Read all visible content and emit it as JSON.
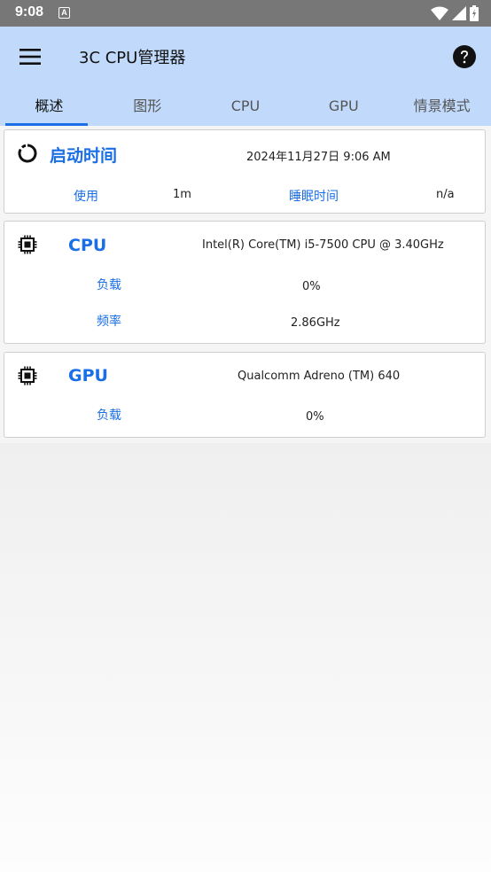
{
  "status_bar": {
    "time": "9:08",
    "notification_icon": "A"
  },
  "app_bar": {
    "title": "3C CPU管理器"
  },
  "tabs": [
    {
      "label": "概述",
      "active": true
    },
    {
      "label": "图形",
      "active": false
    },
    {
      "label": "CPU",
      "active": false
    },
    {
      "label": "GPU",
      "active": false
    },
    {
      "label": "情景模式",
      "active": false
    }
  ],
  "uptime_card": {
    "title": "启动时间",
    "boot_time": "2024年11月27日 9:06 AM",
    "usage_label": "使用",
    "usage_value": "1m",
    "sleep_label": "睡眠时间",
    "sleep_value": "n/a"
  },
  "cpu_card": {
    "title": "CPU",
    "model": "Intel(R) Core(TM) i5-7500 CPU @ 3.40GHz",
    "load_label": "负载",
    "load_value": "0%",
    "freq_label": "频率",
    "freq_value": "2.86GHz"
  },
  "gpu_card": {
    "title": "GPU",
    "model": "Qualcomm Adreno (TM) 640",
    "load_label": "负载",
    "load_value": "0%"
  },
  "colors": {
    "accent": "#1a6ee6",
    "appbar": "#c1dafb",
    "statusbar": "#777777"
  }
}
